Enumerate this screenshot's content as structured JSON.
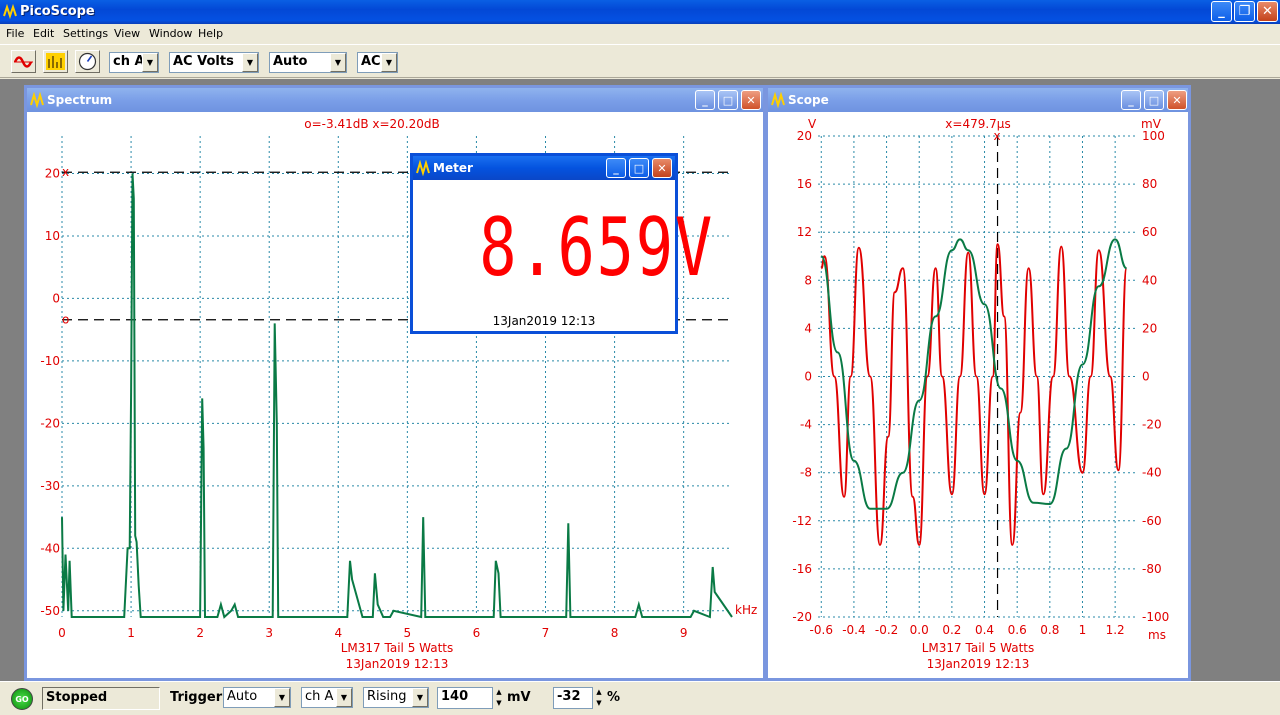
{
  "app": {
    "title": "PicoScope"
  },
  "menu": [
    "File",
    "Edit",
    "Settings",
    "View",
    "Window",
    "Help"
  ],
  "toolbar": {
    "channel": "ch A",
    "mode": "AC Volts",
    "range": "Auto",
    "coupling": "AC"
  },
  "spectrum": {
    "title": "Spectrum",
    "readout": "o=-3.41dB  x=20.20dB",
    "footer": [
      "LM317 Tail 5 Watts",
      "13Jan2019  12:13"
    ],
    "marker_x": "x",
    "marker_o": "o",
    "chart_data": {
      "type": "line",
      "xlabel": "kHz",
      "ylabel": "",
      "xlim": [
        0,
        9.7
      ],
      "ylim": [
        -51,
        26
      ],
      "xticks": [
        0,
        1,
        2,
        3,
        4,
        5,
        6,
        7,
        8,
        9
      ],
      "yticks": [
        20,
        10,
        0,
        -10,
        -20,
        -30,
        -40,
        -50
      ],
      "markers": {
        "x": 20.2,
        "o": -3.41
      },
      "series": [
        {
          "x": [
            0,
            0.02,
            0.05,
            0.09,
            0.11,
            0.14,
            0.9,
            0.95,
            0.98,
            1.0,
            1.02,
            1.04,
            1.06,
            1.08,
            1.11,
            1.14,
            1.17,
            1.22,
            2.0,
            2.03,
            2.05,
            2.07,
            2.1,
            2.25,
            2.3,
            2.35,
            2.45,
            2.5,
            2.55,
            3.05,
            3.08,
            3.11,
            3.13,
            3.16,
            4.13,
            4.17,
            4.2,
            4.35,
            4.5,
            4.53,
            4.57,
            4.65,
            4.75,
            4.8,
            5.2,
            5.23,
            5.26,
            6.25,
            6.28,
            6.32,
            6.35,
            7.3,
            7.33,
            7.36,
            8.3,
            8.35,
            8.4,
            8.9,
            9.1,
            9.15,
            9.38,
            9.42,
            9.45,
            9.7
          ],
          "y": [
            -35,
            -50,
            -41,
            -50,
            -42,
            -51,
            -51,
            -40,
            -40,
            -15,
            20,
            16,
            -38,
            -39,
            -46,
            -51,
            -51,
            -51,
            -51,
            -16,
            -24,
            -51,
            -51,
            -51,
            -49,
            -51,
            -50,
            -49,
            -51,
            -51,
            -4,
            -20,
            -51,
            -51,
            -51,
            -42,
            -45,
            -51,
            -51,
            -44,
            -49,
            -51,
            -51,
            -50,
            -51,
            -35,
            -51,
            -51,
            -42,
            -44,
            -51,
            -51,
            -36,
            -51,
            -51,
            -49,
            -51,
            -51,
            -51,
            -50,
            -51,
            -43,
            -47,
            -51
          ]
        }
      ]
    }
  },
  "scope": {
    "title": "Scope",
    "cursor": "x=479.7µs",
    "cursor_mark": "x",
    "left_unit": "V",
    "right_unit": "mV",
    "footer": [
      "LM317 Tail 5 Watts",
      "13Jan2019  12:13"
    ],
    "chart_data": {
      "type": "line",
      "xlabel": "ms",
      "xlim": [
        -0.62,
        1.34
      ],
      "xticks": [
        -0.6,
        -0.4,
        -0.2,
        0.0,
        0.2,
        0.4,
        0.6,
        0.8,
        1.0,
        1.2
      ],
      "ylim_left": [
        -20,
        20
      ],
      "yticks_left": [
        20,
        16,
        12,
        8,
        4,
        0,
        -4,
        -8,
        -12,
        -16,
        -20
      ],
      "ylim_right": [
        -100,
        100
      ],
      "yticks_right": [
        100,
        80,
        60,
        40,
        20,
        0,
        -20,
        -40,
        -60,
        -80,
        -100
      ],
      "cursor_x": 0.4797,
      "series": [
        {
          "color": "#e00000",
          "axis": "left",
          "x": [
            -0.6,
            -0.58,
            -0.52,
            -0.46,
            -0.42,
            -0.37,
            -0.3,
            -0.24,
            -0.19,
            -0.15,
            -0.1,
            -0.04,
            0.0,
            0.05,
            0.1,
            0.14,
            0.2,
            0.25,
            0.3,
            0.35,
            0.4,
            0.45,
            0.48,
            0.52,
            0.57,
            0.62,
            0.67,
            0.72,
            0.76,
            0.82,
            0.87,
            0.92,
            1.0,
            1.05,
            1.1,
            1.17,
            1.22,
            1.27
          ],
          "y": [
            9,
            10,
            0,
            -10,
            0,
            10.7,
            0,
            -14,
            -5,
            7,
            9,
            -10,
            -14,
            0,
            9,
            0,
            -9.8,
            0,
            10.3,
            0,
            -9.8,
            0,
            11,
            5,
            -14,
            -3,
            9,
            0,
            -9.8,
            0,
            10.8,
            0,
            -8,
            0,
            10.5,
            0,
            -7.8,
            9
          ]
        },
        {
          "color": "#0a7a45",
          "axis": "left",
          "x": [
            -0.6,
            -0.5,
            -0.4,
            -0.3,
            -0.2,
            -0.1,
            0.0,
            0.1,
            0.2,
            0.25,
            0.3,
            0.4,
            0.5,
            0.6,
            0.7,
            0.8,
            0.9,
            1.0,
            1.1,
            1.2,
            1.27
          ],
          "y": [
            10,
            2,
            -7,
            -11,
            -11,
            -8,
            -2,
            5,
            10.5,
            11.4,
            10.5,
            6,
            -1,
            -7,
            -10.5,
            -10.6,
            -6,
            1,
            7.5,
            11.4,
            9
          ]
        }
      ]
    }
  },
  "meter": {
    "title": "Meter",
    "value": "8.659V",
    "stamp": "13Jan2019  12:13"
  },
  "status": {
    "go_label": "GO",
    "state": "Stopped",
    "trigger_label": "Trigger",
    "trigger_mode": "Auto",
    "trigger_channel": "ch A",
    "trigger_edge": "Rising",
    "level": "140",
    "level_unit": "mV",
    "pretrigger": "-32",
    "pretrigger_unit": "%"
  }
}
